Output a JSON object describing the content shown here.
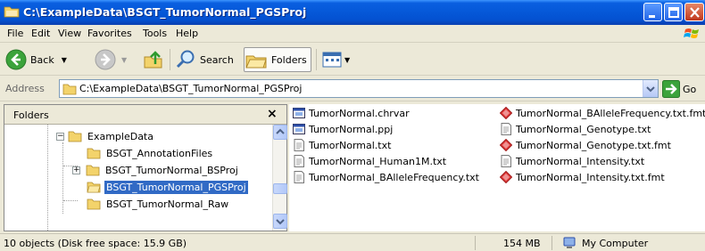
{
  "window": {
    "title": "C:\\ExampleData\\BSGT_TumorNormal_PGSProj"
  },
  "menu": [
    "File",
    "Edit",
    "View",
    "Favorites",
    "Tools",
    "Help"
  ],
  "toolbar": {
    "back_label": "Back",
    "search_label": "Search",
    "folders_label": "Folders"
  },
  "address": {
    "label": "Address",
    "value": "C:\\ExampleData\\BSGT_TumorNormal_PGSProj",
    "go_label": "Go"
  },
  "folders_pane": {
    "title": "Folders",
    "items": [
      {
        "label": "ExampleData",
        "expander": "−"
      },
      {
        "label": "BSGT_AnnotationFiles"
      },
      {
        "label": "BSGT_TumorNormal_BSProj",
        "expander": "+"
      },
      {
        "label": "BSGT_TumorNormal_PGSProj",
        "selected": true
      },
      {
        "label": "BSGT_TumorNormal_Raw"
      }
    ]
  },
  "files": {
    "column1": [
      {
        "name": "TumorNormal.chrvar",
        "icon": "app-file-icon"
      },
      {
        "name": "TumorNormal.ppj",
        "icon": "app-file-icon"
      },
      {
        "name": "TumorNormal.txt",
        "icon": "text-file-icon"
      },
      {
        "name": "TumorNormal_Human1M.txt",
        "icon": "text-file-icon"
      },
      {
        "name": "TumorNormal_BAlleleFrequency.txt",
        "icon": "text-file-icon"
      }
    ],
    "column2": [
      {
        "name": "TumorNormal_BAlleleFrequency.txt.fmt",
        "icon": "fmt-file-icon"
      },
      {
        "name": "TumorNormal_Genotype.txt",
        "icon": "text-file-icon"
      },
      {
        "name": "TumorNormal_Genotype.txt.fmt",
        "icon": "fmt-file-icon"
      },
      {
        "name": "TumorNormal_Intensity.txt",
        "icon": "text-file-icon"
      },
      {
        "name": "TumorNormal_Intensity.txt.fmt",
        "icon": "fmt-file-icon"
      }
    ]
  },
  "status": {
    "objects": "10 objects (Disk free space: 15.9 GB)",
    "size": "154 MB",
    "location": "My Computer"
  },
  "colors": {
    "titlebar": "#0558D8",
    "selection": "#316AC5",
    "chrome": "#ECE9D8"
  }
}
